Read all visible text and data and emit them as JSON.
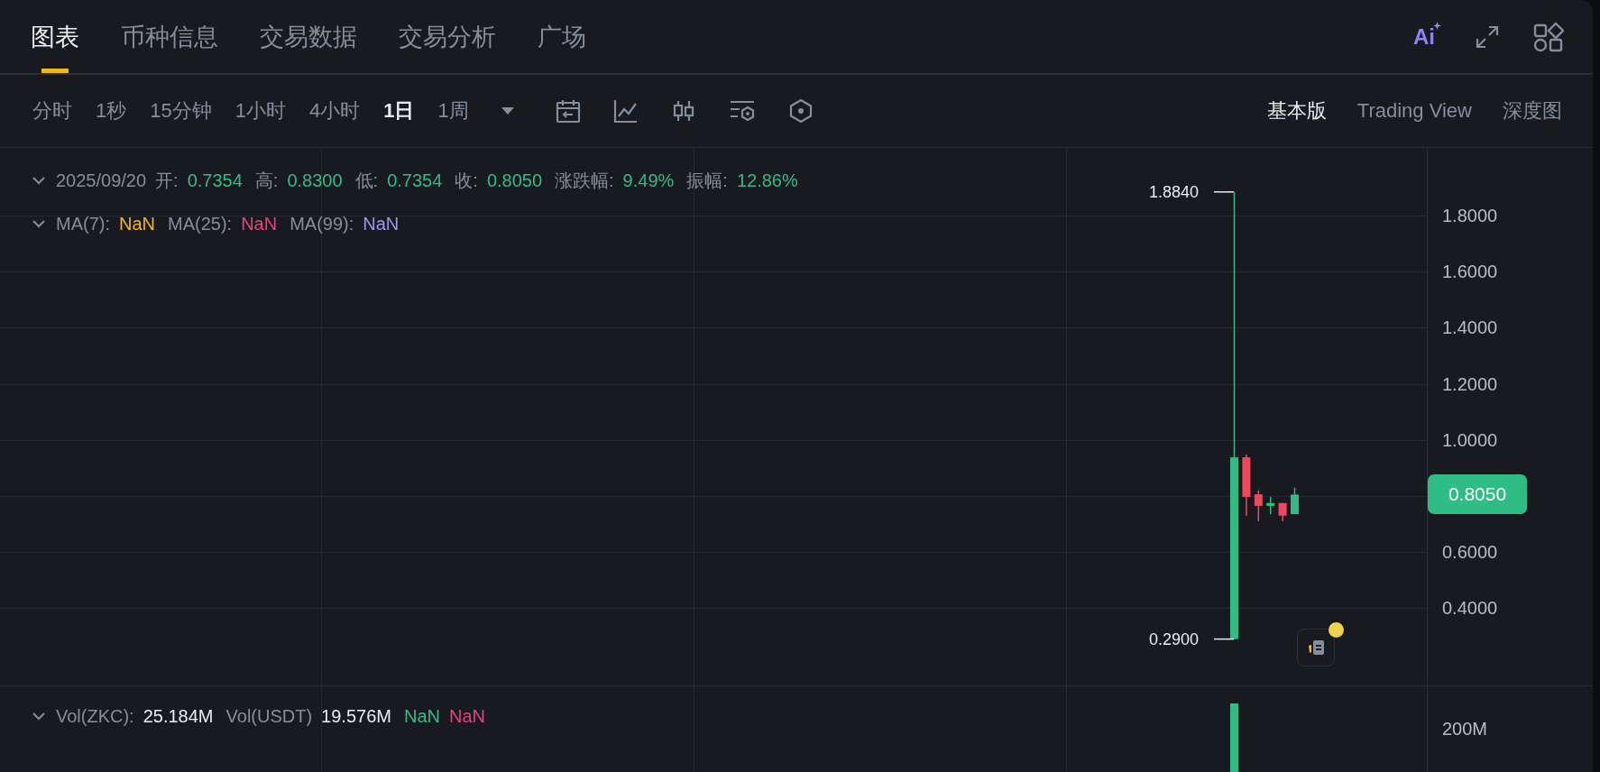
{
  "tabs": [
    {
      "label": "图表",
      "selected": true
    },
    {
      "label": "币种信息",
      "selected": false
    },
    {
      "label": "交易数据",
      "selected": false
    },
    {
      "label": "交易分析",
      "selected": false
    },
    {
      "label": "广场",
      "selected": false
    }
  ],
  "ai_button": {
    "label": "Ai"
  },
  "intervals": [
    {
      "label": "分时",
      "selected": false
    },
    {
      "label": "1秒",
      "selected": false
    },
    {
      "label": "15分钟",
      "selected": false
    },
    {
      "label": "1小时",
      "selected": false
    },
    {
      "label": "4小时",
      "selected": false
    },
    {
      "label": "1日",
      "selected": true
    },
    {
      "label": "1周",
      "selected": false
    }
  ],
  "views": [
    {
      "label": "基本版",
      "selected": true
    },
    {
      "label": "Trading View",
      "selected": false
    },
    {
      "label": "深度图",
      "selected": false
    }
  ],
  "ohlc_legend": {
    "date": "2025/09/20",
    "fields": [
      {
        "label": "开:",
        "value": "0.7354"
      },
      {
        "label": "高:",
        "value": "0.8300"
      },
      {
        "label": "低:",
        "value": "0.7354"
      },
      {
        "label": "收:",
        "value": "0.8050"
      },
      {
        "label": "涨跌幅:",
        "value": "9.49%"
      },
      {
        "label": "振幅:",
        "value": "12.86%"
      }
    ]
  },
  "ma_legend": [
    {
      "label": "MA(7):",
      "value": "NaN",
      "color": "#f0b90b"
    },
    {
      "label": "MA(25):",
      "value": "NaN",
      "color": "#e0457b"
    },
    {
      "label": "MA(99):",
      "value": "NaN",
      "color": "#a195e8"
    }
  ],
  "price_chart": {
    "kind": "picture",
    "high_label": "1.8840",
    "low_label": "0.2900"
  },
  "price_axis": {
    "ticks": [
      "1.8000",
      "1.6000",
      "1.4000",
      "1.2000",
      "1.0000",
      "0.6000",
      "0.4000"
    ],
    "last_price": "0.8050"
  },
  "volume_legend": {
    "items": [
      {
        "label": "Vol(ZKC):",
        "value": "25.184M"
      },
      {
        "label": "Vol(USDT)",
        "value": "19.576M"
      }
    ],
    "ma": [
      {
        "value": "NaN",
        "color": "#2ebd85"
      },
      {
        "value": "NaN",
        "color": "#e0457b"
      }
    ]
  },
  "volume_axis": {
    "ticks": [
      "200M"
    ]
  }
}
